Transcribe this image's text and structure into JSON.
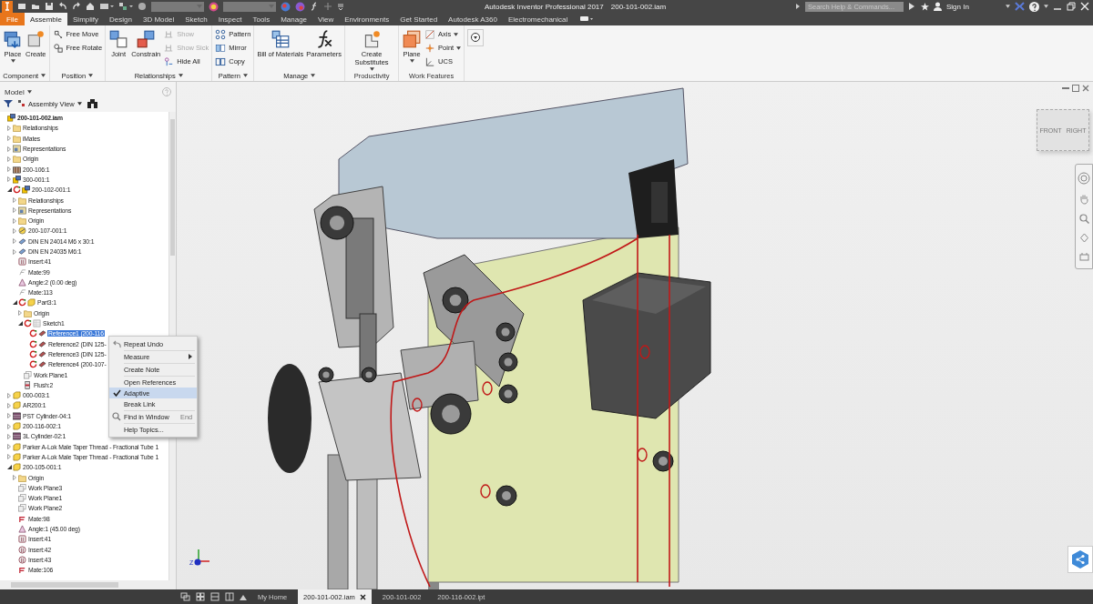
{
  "title_bar": {
    "app_title": "Autodesk Inventor Professional 2017",
    "document": "200-101-002.iam",
    "search": {
      "placeholder": "Search Help & Commands..."
    },
    "sign_in": "Sign In"
  },
  "ribbon_tabs": [
    {
      "label": "File",
      "kind": "file",
      "selected": false
    },
    {
      "label": "Assemble",
      "kind": "tab",
      "selected": true
    },
    {
      "label": "Simplify",
      "kind": "tab",
      "selected": false
    },
    {
      "label": "Design",
      "kind": "tab",
      "selected": false
    },
    {
      "label": "3D Model",
      "kind": "tab",
      "selected": false
    },
    {
      "label": "Sketch",
      "kind": "tab",
      "selected": false
    },
    {
      "label": "Inspect",
      "kind": "tab",
      "selected": false
    },
    {
      "label": "Tools",
      "kind": "tab",
      "selected": false
    },
    {
      "label": "Manage",
      "kind": "tab",
      "selected": false
    },
    {
      "label": "View",
      "kind": "tab",
      "selected": false
    },
    {
      "label": "Environments",
      "kind": "tab",
      "selected": false
    },
    {
      "label": "Get Started",
      "kind": "tab",
      "selected": false
    },
    {
      "label": "Autodesk A360",
      "kind": "tab",
      "selected": false
    },
    {
      "label": "Electromechanical",
      "kind": "tab",
      "selected": false
    }
  ],
  "ribbon_groups": [
    {
      "label": "Component",
      "menu": true,
      "items": [
        {
          "label": "Place",
          "kind": "large",
          "dropdown": true,
          "disabled": false
        },
        {
          "label": "Create",
          "kind": "large",
          "dropdown": false,
          "disabled": false
        }
      ]
    },
    {
      "label": "Position",
      "menu": true,
      "items": [
        {
          "label": "Free Move",
          "kind": "small",
          "dropdown": false,
          "disabled": false
        },
        {
          "label": "Free Rotate",
          "kind": "small",
          "dropdown": false,
          "disabled": false
        }
      ]
    },
    {
      "label": "Relationships",
      "menu": true,
      "items": [
        {
          "label": "Joint",
          "kind": "large",
          "dropdown": false,
          "disabled": false
        },
        {
          "label": "Constrain",
          "kind": "large",
          "dropdown": false,
          "disabled": false
        },
        {
          "label": "Show",
          "kind": "small",
          "dropdown": false,
          "disabled": true
        },
        {
          "label": "Show Sick",
          "kind": "small",
          "dropdown": false,
          "disabled": true
        },
        {
          "label": "Hide All",
          "kind": "small",
          "dropdown": false,
          "disabled": false
        }
      ]
    },
    {
      "label": "Pattern",
      "menu": true,
      "items": [
        {
          "label": "Pattern",
          "kind": "small",
          "dropdown": false,
          "disabled": false
        },
        {
          "label": "Mirror",
          "kind": "small",
          "dropdown": false,
          "disabled": false
        },
        {
          "label": "Copy",
          "kind": "small",
          "dropdown": false,
          "disabled": false
        }
      ]
    },
    {
      "label": "Manage",
      "menu": true,
      "items": [
        {
          "label": "Bill of Materials",
          "kind": "large",
          "dropdown": false,
          "disabled": false
        },
        {
          "label": "Parameters",
          "kind": "large",
          "dropdown": false,
          "disabled": false
        }
      ]
    },
    {
      "label": "Productivity",
      "menu": false,
      "items": [
        {
          "label": "Create Substitutes",
          "kind": "large",
          "dropdown": true,
          "disabled": false
        }
      ]
    },
    {
      "label": "Work Features",
      "menu": false,
      "items": [
        {
          "label": "Plane",
          "kind": "large",
          "dropdown": true,
          "disabled": false
        },
        {
          "label": "Axis",
          "kind": "small",
          "dropdown": true,
          "disabled": false
        },
        {
          "label": "Point",
          "kind": "small",
          "dropdown": true,
          "disabled": false
        },
        {
          "label": "UCS",
          "kind": "small",
          "dropdown": false,
          "disabled": false
        }
      ]
    }
  ],
  "model_panel": {
    "title": "Model",
    "view": "Assembly View",
    "tree": [
      {
        "label": "200-101-002.iam",
        "kind": "assembly",
        "adaptive": false,
        "selected": false,
        "children": [
          {
            "label": "Relationships",
            "kind": "folder",
            "adaptive": false,
            "selected": false,
            "expanded": false
          },
          {
            "label": "iMates",
            "kind": "folder",
            "adaptive": false,
            "selected": false,
            "expanded": false
          },
          {
            "label": "Representations",
            "kind": "representations",
            "adaptive": false,
            "selected": false,
            "expanded": false
          },
          {
            "label": "Origin",
            "kind": "folder",
            "adaptive": false,
            "selected": false,
            "expanded": false
          },
          {
            "label": "200-106:1",
            "kind": "weldment",
            "adaptive": false,
            "selected": false,
            "expanded": false
          },
          {
            "label": "300-001:1",
            "kind": "assembly",
            "adaptive": false,
            "selected": false,
            "expanded": false
          },
          {
            "label": "200-102-001:1",
            "kind": "assembly",
            "adaptive": true,
            "selected": false,
            "expanded": true,
            "children": [
              {
                "label": "Relationships",
                "kind": "folder",
                "adaptive": false,
                "selected": false,
                "expanded": false
              },
              {
                "label": "Representations",
                "kind": "representations",
                "adaptive": false,
                "selected": false,
                "expanded": false
              },
              {
                "label": "Origin",
                "kind": "folder",
                "adaptive": false,
                "selected": false,
                "expanded": false
              },
              {
                "label": "200-107-001:1",
                "kind": "spring",
                "adaptive": false,
                "selected": false,
                "expanded": false
              },
              {
                "label": "DIN EN 24014 M6 x 30:1",
                "kind": "fastener",
                "adaptive": false,
                "selected": false,
                "expanded": false
              },
              {
                "label": "DIN EN 24035 M6:1",
                "kind": "fastener",
                "adaptive": false,
                "selected": false,
                "expanded": false
              },
              {
                "label": "Insert:41",
                "kind": "insert",
                "adaptive": false,
                "selected": false
              },
              {
                "label": "Mate:99",
                "kind": "mate-suppressed",
                "adaptive": false,
                "selected": false
              },
              {
                "label": "Angle:2 (0.00 deg)",
                "kind": "angle",
                "adaptive": false,
                "selected": false
              },
              {
                "label": "Mate:113",
                "kind": "mate-suppressed",
                "adaptive": false,
                "selected": false
              },
              {
                "label": "Part3:1",
                "kind": "part",
                "adaptive": true,
                "selected": false,
                "expanded": true,
                "children": [
                  {
                    "label": "Origin",
                    "kind": "folder",
                    "adaptive": false,
                    "selected": false,
                    "expanded": false
                  },
                  {
                    "label": "Sketch1",
                    "kind": "sketch",
                    "adaptive": true,
                    "selected": false,
                    "expanded": true,
                    "children": [
                      {
                        "label": "Reference1 (200-116",
                        "kind": "reference",
                        "adaptive": true,
                        "selected": true
                      },
                      {
                        "label": "Reference2 (DIN 125-",
                        "kind": "reference",
                        "adaptive": true,
                        "selected": false
                      },
                      {
                        "label": "Reference3 (DIN 125-",
                        "kind": "reference",
                        "adaptive": true,
                        "selected": false
                      },
                      {
                        "label": "Reference4 (200-107-",
                        "kind": "reference",
                        "adaptive": true,
                        "selected": false
                      }
                    ]
                  },
                  {
                    "label": "Work Plane1",
                    "kind": "plane",
                    "adaptive": false,
                    "selected": false
                  },
                  {
                    "label": "Flush:2",
                    "kind": "flush",
                    "adaptive": false,
                    "selected": false
                  }
                ]
              }
            ]
          },
          {
            "label": "000-003:1",
            "kind": "part",
            "adaptive": false,
            "selected": false,
            "expanded": false
          },
          {
            "label": "AR200:1",
            "kind": "part",
            "adaptive": false,
            "selected": false,
            "expanded": false
          },
          {
            "label": "PST Cylinder-04:1",
            "kind": "cylinder",
            "adaptive": false,
            "selected": false,
            "expanded": false
          },
          {
            "label": "200-116-002:1",
            "kind": "part",
            "adaptive": false,
            "selected": false,
            "expanded": false
          },
          {
            "label": "3L Cylinder-02:1",
            "kind": "cylinder",
            "adaptive": false,
            "selected": false,
            "expanded": false
          },
          {
            "label": "Parker A-Lok Male Taper Thread - Fractional Tube 1",
            "kind": "part",
            "adaptive": false,
            "selected": false,
            "expanded": false
          },
          {
            "label": "Parker A-Lok Male Taper Thread - Fractional Tube 1",
            "kind": "part",
            "adaptive": false,
            "selected": false,
            "expanded": false
          },
          {
            "label": "200-105-001:1",
            "kind": "part",
            "adaptive": false,
            "selected": false,
            "expanded": true,
            "children": [
              {
                "label": "Origin",
                "kind": "folder",
                "adaptive": false,
                "selected": false,
                "expanded": false
              },
              {
                "label": "Work Plane3",
                "kind": "plane",
                "adaptive": false,
                "selected": false
              },
              {
                "label": "Work Plane1",
                "kind": "plane",
                "adaptive": false,
                "selected": false
              },
              {
                "label": "Work Plane2",
                "kind": "plane",
                "adaptive": false,
                "selected": false
              },
              {
                "label": "Mate:98",
                "kind": "mate",
                "adaptive": false,
                "selected": false
              },
              {
                "label": "Angle:1 (45.00 deg)",
                "kind": "angle",
                "adaptive": false,
                "selected": false
              },
              {
                "label": "Insert:41",
                "kind": "insert",
                "adaptive": false,
                "selected": false
              },
              {
                "label": "Insert:42",
                "kind": "insert-round",
                "adaptive": false,
                "selected": false
              },
              {
                "label": "Insert:43",
                "kind": "insert-round",
                "adaptive": false,
                "selected": false
              },
              {
                "label": "Mate:106",
                "kind": "mate",
                "adaptive": false,
                "selected": false
              }
            ]
          }
        ]
      }
    ]
  },
  "context_menu": [
    {
      "kind": "item",
      "label": "Repeat Undo",
      "submenu": false,
      "checked": false,
      "highlighted": false
    },
    {
      "kind": "separator"
    },
    {
      "kind": "item",
      "label": "Measure",
      "submenu": true,
      "checked": false,
      "highlighted": false
    },
    {
      "kind": "separator"
    },
    {
      "kind": "item",
      "label": "Create Note",
      "submenu": false,
      "checked": false,
      "highlighted": false
    },
    {
      "kind": "separator"
    },
    {
      "kind": "item",
      "label": "Open References",
      "submenu": false,
      "checked": false,
      "highlighted": false
    },
    {
      "kind": "item",
      "label": "Adaptive",
      "submenu": false,
      "checked": true,
      "highlighted": true
    },
    {
      "kind": "item",
      "label": "Break Link",
      "submenu": false,
      "checked": false,
      "highlighted": false
    },
    {
      "kind": "separator"
    },
    {
      "kind": "item",
      "label": "Find in Window",
      "shortcut": "End",
      "submenu": false,
      "checked": false,
      "highlighted": false
    },
    {
      "kind": "separator"
    },
    {
      "kind": "item",
      "label": "Help Topics...",
      "submenu": false,
      "checked": false,
      "highlighted": false
    }
  ],
  "viewport": {
    "view_cube": [
      "FRONT",
      "RIGHT"
    ],
    "triad_label": "Z"
  },
  "document_tabs": [
    {
      "label": "My Home",
      "selected": false,
      "closable": false
    },
    {
      "label": "200-101-002.iam",
      "selected": true,
      "closable": true
    },
    {
      "label": "200-101-002",
      "selected": false,
      "closable": false
    },
    {
      "label": "200-116-002.ipt",
      "selected": false,
      "closable": false
    }
  ]
}
